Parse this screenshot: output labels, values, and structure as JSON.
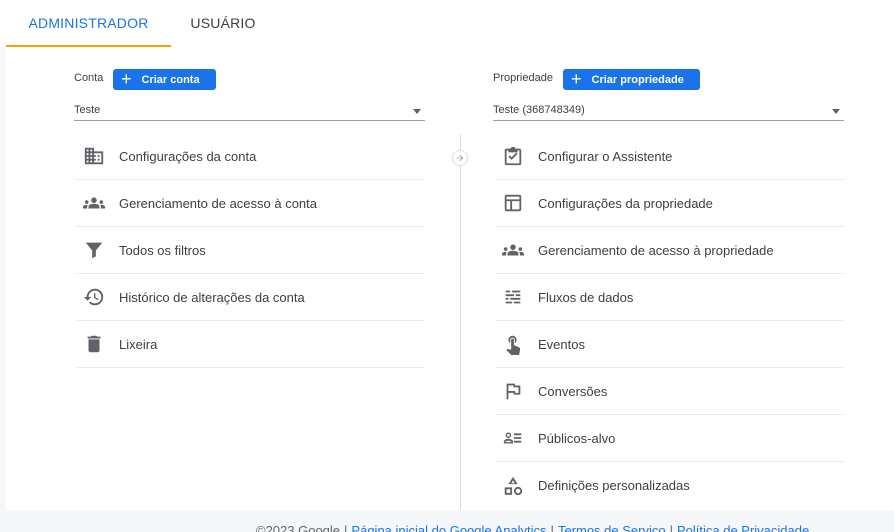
{
  "tabs": [
    {
      "label": "ADMINISTRADOR",
      "active": true
    },
    {
      "label": "USUÁRIO",
      "active": false
    }
  ],
  "account": {
    "label": "Conta",
    "create_label": "Criar conta",
    "selected": "Teste",
    "items": [
      {
        "label": "Configurações da conta",
        "icon": "building-icon"
      },
      {
        "label": "Gerenciamento de acesso à conta",
        "icon": "people-icon"
      },
      {
        "label": "Todos os filtros",
        "icon": "filter-icon"
      },
      {
        "label": "Histórico de alterações da conta",
        "icon": "history-icon"
      },
      {
        "label": "Lixeira",
        "icon": "trash-icon"
      }
    ]
  },
  "property": {
    "label": "Propriedade",
    "create_label": "Criar propriedade",
    "selected": "Teste (368748349)",
    "items": [
      {
        "label": "Configurar o Assistente",
        "icon": "checkbox-icon"
      },
      {
        "label": "Configurações da propriedade",
        "icon": "layout-icon"
      },
      {
        "label": "Gerenciamento de acesso à propriedade",
        "icon": "people-icon"
      },
      {
        "label": "Fluxos de dados",
        "icon": "streams-icon"
      },
      {
        "label": "Eventos",
        "icon": "touch-icon"
      },
      {
        "label": "Conversões",
        "icon": "flag-icon"
      },
      {
        "label": "Públicos-alvo",
        "icon": "audience-icon"
      },
      {
        "label": "Definições personalizadas",
        "icon": "shapes-icon"
      }
    ]
  },
  "footer": {
    "copyright": "©2023 Google",
    "links": [
      "Página inicial do Google Analytics",
      "Termos de Serviço",
      "Política de Privacidade"
    ]
  },
  "colors": {
    "accent": "#1a73e8",
    "tab_underline": "#f4a300"
  }
}
